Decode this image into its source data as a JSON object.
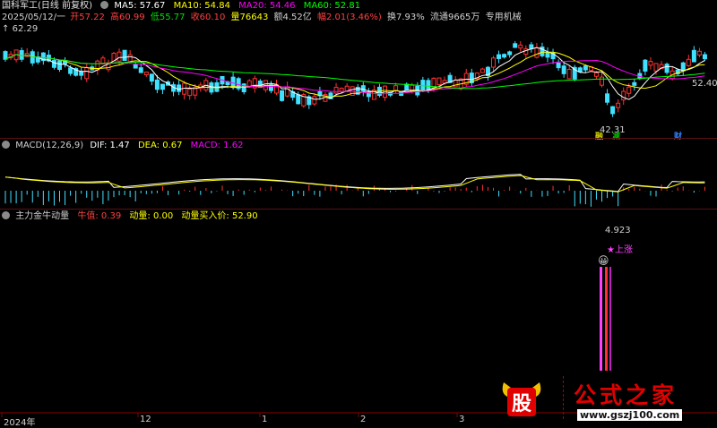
{
  "header": {
    "stock": "国科军工(日线 前复权)",
    "ma": [
      {
        "label": "MA5: 57.67",
        "color": "#ffffff"
      },
      {
        "label": "MA10: 54.84",
        "color": "#ffff00"
      },
      {
        "label": "MA20: 54.46",
        "color": "#ff00ff"
      },
      {
        "label": "MA60: 52.81",
        "color": "#00ff00"
      }
    ]
  },
  "quote": {
    "date": "2025/05/12/一",
    "open": "开57.22",
    "high": "高60.99",
    "low": "低55.77",
    "close": "收60.10",
    "volume": "量76643",
    "amount": "额4.52亿",
    "change": "幅2.01(3.46%)",
    "turnover": "换7.93%",
    "float": "流通9665万",
    "industry": "专用机械"
  },
  "price_chart": {
    "high_marker": "62.29",
    "low_marker": "42.31",
    "right_label": "52.40",
    "event_badges": [
      {
        "text": "融",
        "color": "#d0d000"
      },
      {
        "text": "减",
        "color": "#00c000"
      },
      {
        "text": "财",
        "color": "#3080ff"
      }
    ]
  },
  "macd": {
    "title": "MACD(12,26,9)",
    "dif": "DIF: 1.47",
    "dea": "DEA: 0.67",
    "macd": "MACD: 1.62",
    "colors": {
      "dif": "#ffffff",
      "dea": "#ffff00",
      "macd": "#ff00ff",
      "up": "#ff3030",
      "down": "#40e0ff"
    }
  },
  "indicator": {
    "title": "主力金牛动量",
    "niu_zhi": "牛值: 0.39",
    "dong_liang": "动量: 0.00",
    "buy_price": "动量买入价: 52.90",
    "peak_value": "4.923",
    "signal_label": "★上涨"
  },
  "time_axis": {
    "labels": [
      "2024年",
      "12",
      "1",
      "2",
      "3"
    ]
  },
  "watermark": {
    "logo_glyph": "股",
    "brand": "公式之家",
    "url": "www.gszj100.com"
  }
}
